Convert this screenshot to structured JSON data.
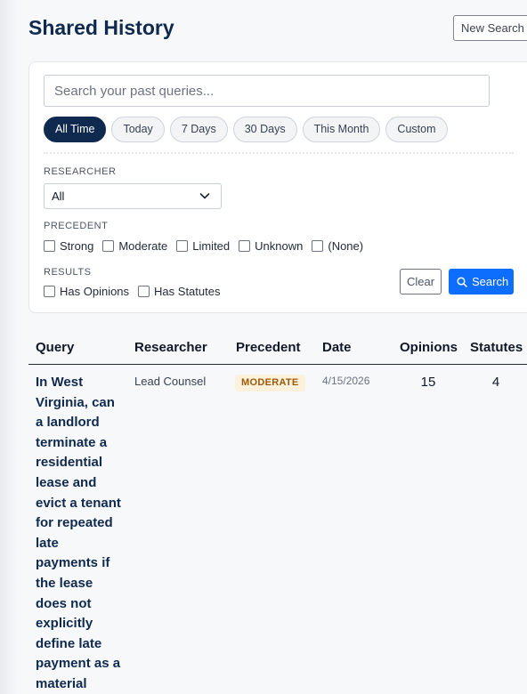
{
  "page": {
    "title": "Shared History",
    "new_search_label": "New Search"
  },
  "filters": {
    "search_placeholder": "Search your past queries...",
    "search_value": "",
    "date_ranges": [
      "All Time",
      "Today",
      "7 Days",
      "30 Days",
      "This Month",
      "Custom"
    ],
    "active_range": "All Time",
    "researcher_label": "RESEARCHER",
    "researcher_selected": "All",
    "precedent_label": "PRECEDENT",
    "precedent_options": [
      "Strong",
      "Moderate",
      "Limited",
      "Unknown",
      "(None)"
    ],
    "results_label": "RESULTS",
    "results_options": [
      "Has Opinions",
      "Has Statutes"
    ],
    "clear_label": "Clear",
    "search_label": "Search"
  },
  "table": {
    "columns": [
      "Query",
      "Researcher",
      "Precedent",
      "Date",
      "Opinions",
      "Statutes"
    ],
    "rows": [
      {
        "query": "In West Virginia, can a landlord terminate a residential lease and evict a tenant for repeated late payments if the lease does not explicitly define late payment as a material breach?",
        "researcher": "Lead Counsel",
        "precedent": "MODERATE",
        "date": "4/15/2026",
        "opinions": "15",
        "statutes": "4"
      }
    ]
  },
  "colors": {
    "brand_navy": "#0f2a4e",
    "primary_blue": "#0d6efd",
    "badge_bg": "#fdf1dc",
    "badge_text": "#9a5a0b"
  },
  "icons": [
    "chevron-down-icon",
    "search-icon"
  ]
}
